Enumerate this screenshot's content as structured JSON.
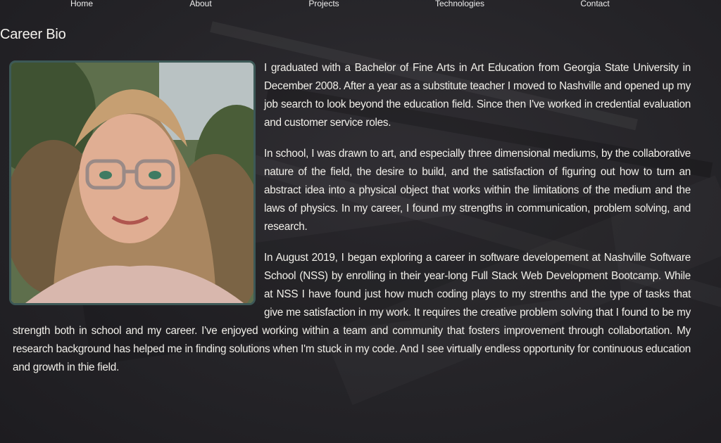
{
  "nav": {
    "home": "Home",
    "about": "About",
    "projects": "Projects",
    "technologies": "Technologies",
    "contact": "Contact"
  },
  "page_title": "Career Bio",
  "bio": {
    "p1": "I graduated with a Bachelor of Fine Arts in Art Education from Georgia State University in December 2008. After a year as a substitute teacher I moved to Nashville and opened up my job search to look beyond the education field. Since then I've worked in credential evaluation and customer service roles.",
    "p2": "In school, I was drawn to art, and especially three dimensional mediums, by the collaborative nature of the field, the desire to build, and the satisfaction of figuring out how to turn an abstract idea into a physical object that works within the limitations of the medium and the laws of physics. In my career, I found my strengths in communication, problem solving, and research.",
    "p3": "In August 2019, I began exploring a career in software developement at Nashville Software School (NSS) by enrolling in their year-long Full Stack Web Development Bootcamp. While at NSS I have found just how much coding plays to my strenths and the type of tasks that give me satisfaction in my work. It requires the creative problem solving that I found to be my strength both in school and my career. I've enjoyed working within a team and community that fosters improvement through collabortation. My research background has helped me in finding solutions when I'm stuck in my code. And I see virtually endless opportunity for continuous education and growth in thie field."
  },
  "colors": {
    "background": "#232226",
    "text": "#f1efe9",
    "photo_border": "#3d5957"
  }
}
